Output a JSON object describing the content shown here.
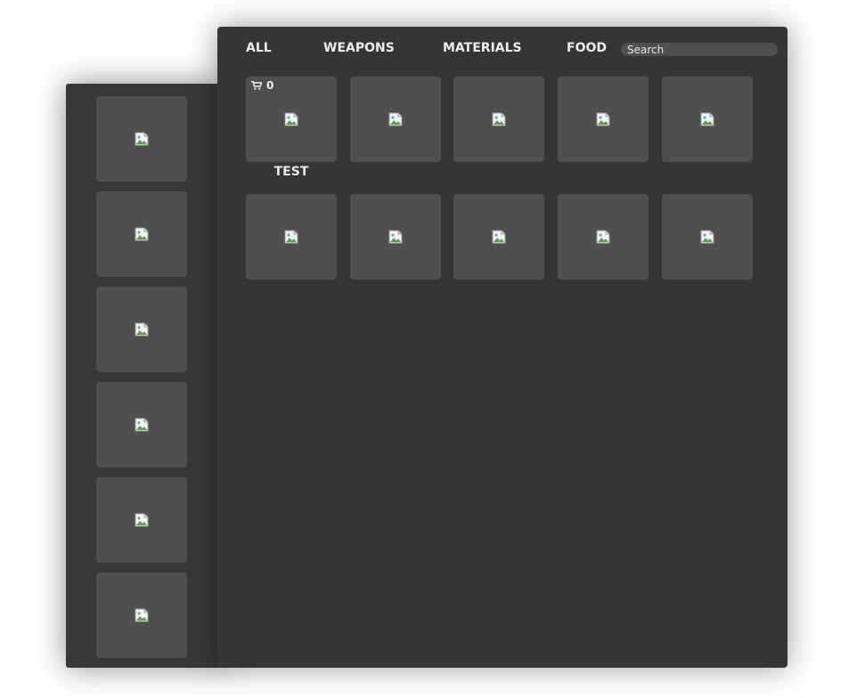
{
  "tabs": {
    "all": "ALL",
    "weapons": "WEAPONS",
    "materials": "MATERIALS",
    "food": "FOOD"
  },
  "search": {
    "placeholder": "Search",
    "value": ""
  },
  "grid": {
    "first_item": {
      "cost": "0",
      "name": "TEST",
      "icon": "cart-icon"
    },
    "slot_count": 10,
    "slot_image": "broken-image-icon"
  },
  "quickbar": {
    "slot_count": 6
  },
  "colors": {
    "panel_main": "#353535",
    "panel_side": "#383838",
    "slot": "#4f4f4f",
    "text": "#ececec"
  }
}
